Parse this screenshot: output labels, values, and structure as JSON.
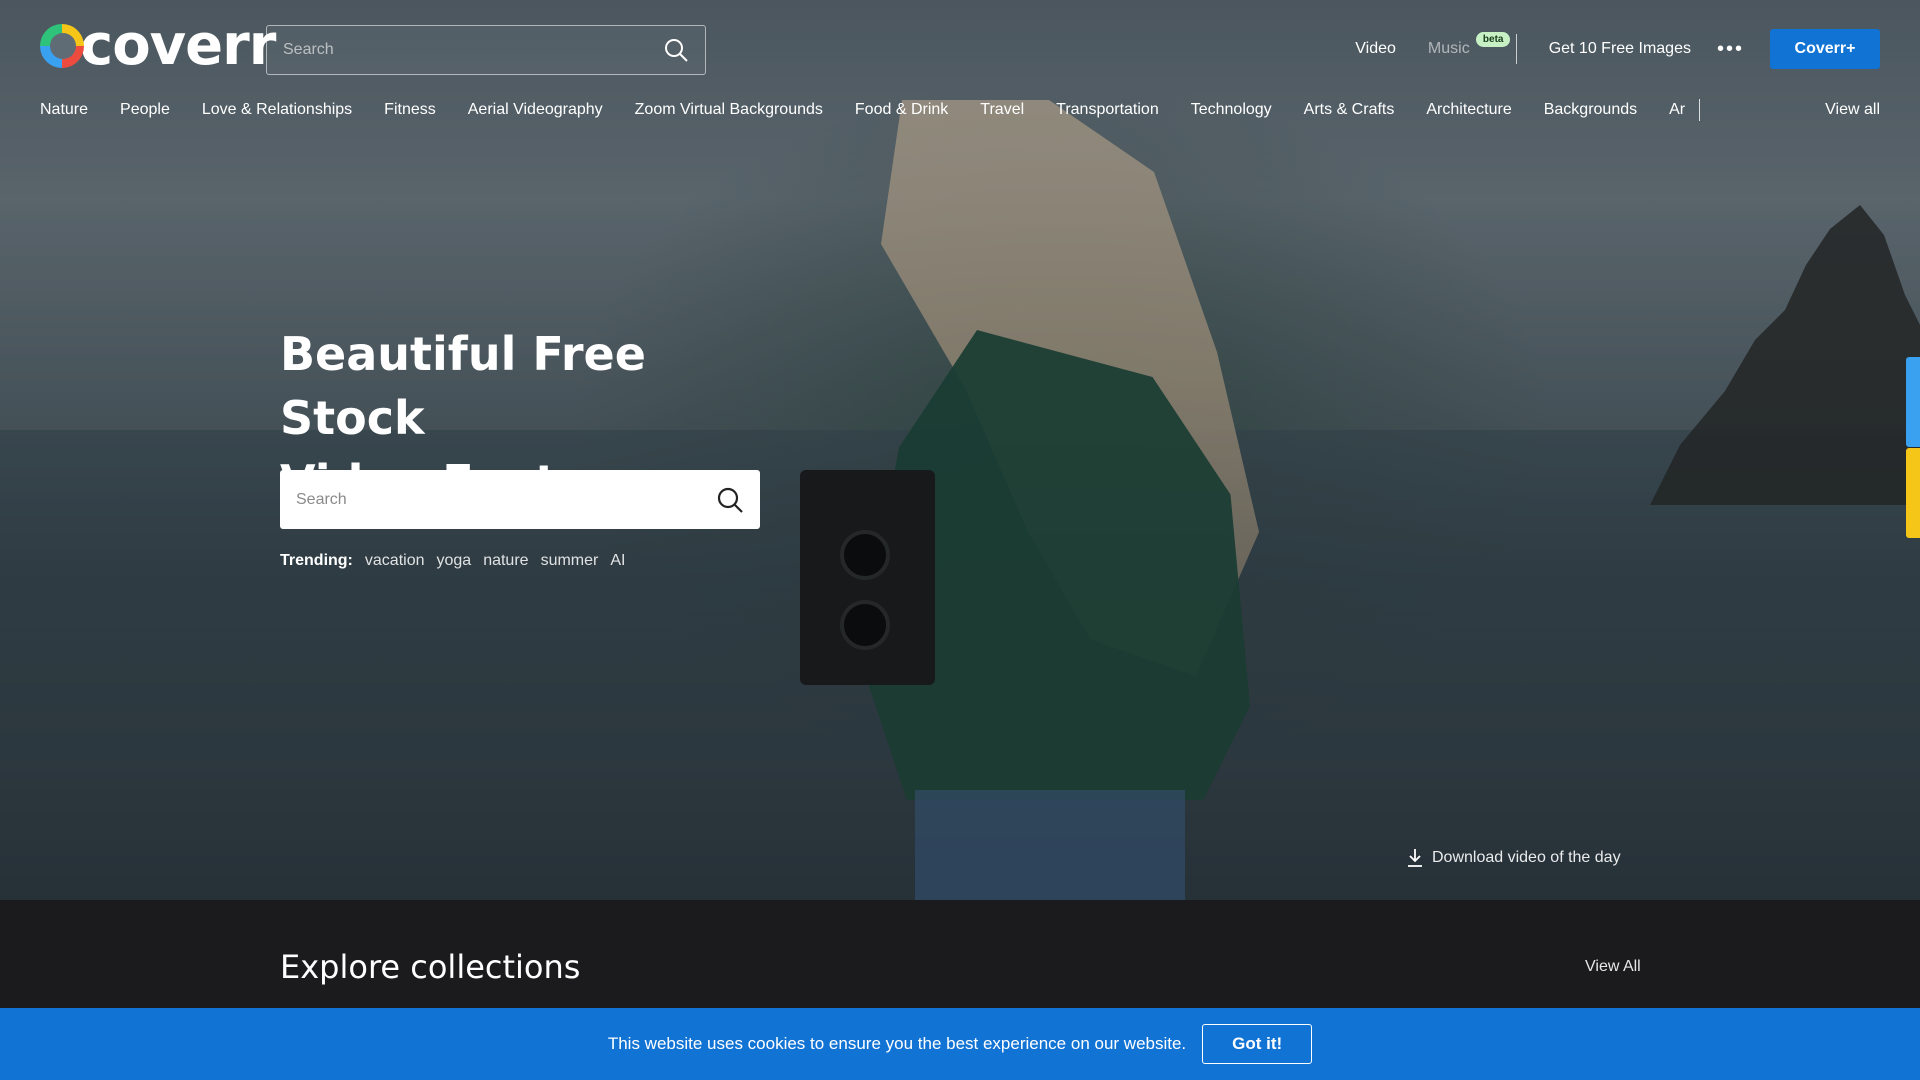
{
  "brand": {
    "logo_text": "coverr"
  },
  "header": {
    "search_placeholder": "Search",
    "nav": {
      "video": "Video",
      "music": "Music",
      "music_badge": "beta",
      "free_images": "Get 10 Free Images",
      "more": "•••",
      "cta": "Coverr+"
    }
  },
  "categories": [
    "Nature",
    "People",
    "Love & Relationships",
    "Fitness",
    "Aerial Videography",
    "Zoom Virtual Backgrounds",
    "Food & Drink",
    "Travel",
    "Transportation",
    "Technology",
    "Arts & Crafts",
    "Architecture",
    "Backgrounds"
  ],
  "categories_truncated": "Ar",
  "categories_view_all": "View all",
  "hero": {
    "headline_line1": "Beautiful Free Stock",
    "headline_line2": "Video Footage",
    "search_placeholder": "Search",
    "trending_label": "Trending:",
    "trending_tags": [
      "vacation",
      "yoga",
      "nature",
      "summer",
      "AI"
    ],
    "download_label": "Download video of the day"
  },
  "explore": {
    "title": "Explore collections",
    "view_all": "View All"
  },
  "cookie": {
    "message": "This website uses cookies to ensure you the best experience on our website.",
    "button": "Got it!"
  },
  "colors": {
    "accent": "#1173d4",
    "beta_badge": "#c7f0c4",
    "page_bg": "#1b1b1e"
  },
  "icons": [
    "search-icon",
    "download-icon",
    "more-dots-icon"
  ]
}
